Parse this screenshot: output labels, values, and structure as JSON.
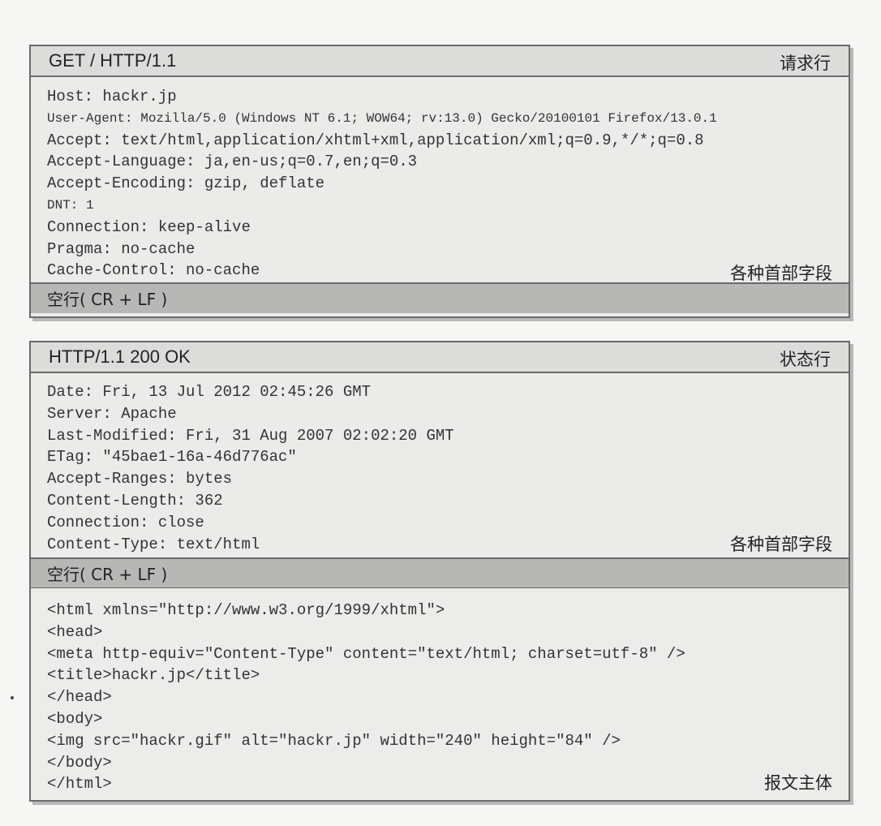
{
  "request": {
    "line": "GET / HTTP/1.1",
    "line_label": "请求行",
    "headers": [
      "Host: hackr.jp",
      "User-Agent: Mozilla/5.0 (Windows NT 6.1; WOW64; rv:13.0) Gecko/20100101 Firefox/13.0.1",
      "Accept: text/html,application/xhtml+xml,application/xml;q=0.9,*/*;q=0.8",
      "Accept-Language: ja,en-us;q=0.7,en;q=0.3",
      "Accept-Encoding: gzip, deflate",
      "DNT: 1",
      "Connection: keep-alive",
      "Pragma: no-cache",
      "Cache-Control: no-cache"
    ],
    "headers_label": "各种首部字段",
    "blank_line": "空行( CR + LF )"
  },
  "response": {
    "line": "HTTP/1.1 200 OK",
    "line_label": "状态行",
    "headers": [
      "Date: Fri, 13 Jul 2012 02:45:26 GMT",
      "Server: Apache",
      "Last-Modified: Fri, 31 Aug 2007 02:02:20 GMT",
      "ETag: \"45bae1-16a-46d776ac\"",
      "Accept-Ranges: bytes",
      "Content-Length: 362",
      "Connection: close",
      "Content-Type: text/html"
    ],
    "headers_label": "各种首部字段",
    "blank_line": "空行( CR + LF )",
    "body": [
      "<html xmlns=\"http://www.w3.org/1999/xhtml\">",
      "<head>",
      "<meta http-equiv=\"Content-Type\" content=\"text/html; charset=utf-8\" />",
      "<title>hackr.jp</title>",
      "</head>",
      "<body>",
      "<img src=\"hackr.gif\" alt=\"hackr.jp\" width=\"240\" height=\"84\" />",
      "</body>",
      "</html>"
    ],
    "body_label": "报文主体"
  }
}
